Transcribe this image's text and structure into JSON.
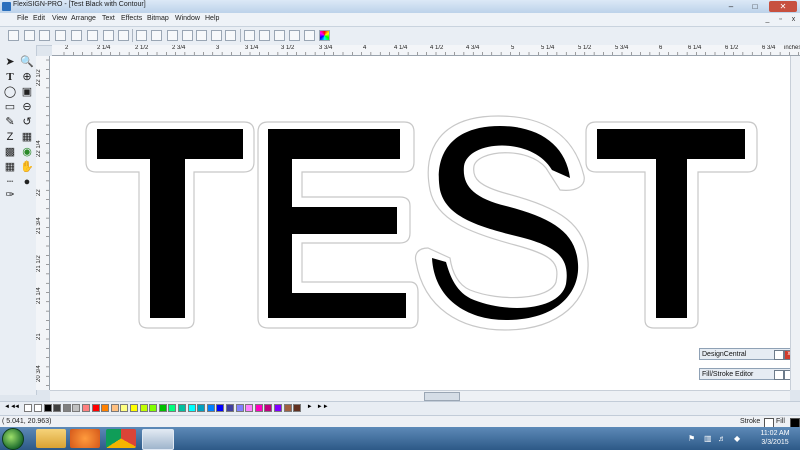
{
  "window": {
    "title": "FlexiSIGN-PRO - [Test Black with Contour]"
  },
  "menu": [
    "File",
    "Edit",
    "View",
    "Arrange",
    "Text",
    "Effects",
    "Bitmap",
    "Window",
    "Help"
  ],
  "ruler": {
    "unit": "inches",
    "h_labels": [
      "2",
      "2 1/4",
      "2 1/2",
      "2 3/4",
      "3",
      "3 1/4",
      "3 1/2",
      "3 3/4",
      "4",
      "4 1/4",
      "4 1/2",
      "4 3/4",
      "5",
      "5 1/4",
      "5 1/2",
      "5 3/4",
      "6",
      "6 1/4",
      "6 1/2",
      "6 3/4"
    ],
    "v_labels": [
      "22 1/2",
      "22 1/4",
      "22",
      "21 3/4",
      "21 1/2",
      "21 1/4",
      "21",
      "20 3/4"
    ]
  },
  "canvas": {
    "text": "TEST"
  },
  "panels": {
    "design_central": "DesignCentral",
    "fill_stroke": "Fill/Stroke Editor"
  },
  "status": {
    "coords": "(      5.041,     20.963)",
    "stroke": "Stroke",
    "fill": "Fill"
  },
  "palette_colors": [
    "#ffffff",
    "#000000",
    "#404040",
    "#808080",
    "#c0c0c0",
    "#ff8080",
    "#ff0000",
    "#ff8000",
    "#ffc080",
    "#ffff80",
    "#ffff00",
    "#c0ff00",
    "#80ff00",
    "#00c000",
    "#00ff80",
    "#00c0a0",
    "#00ffff",
    "#00a0c0",
    "#0080ff",
    "#0000ff",
    "#4040a0",
    "#8080ff",
    "#ff80ff",
    "#ff00c0",
    "#c00080",
    "#8000ff",
    "#a06040",
    "#603020"
  ],
  "taskbar": {
    "time": "11:02 AM",
    "date": "3/3/2015"
  },
  "icons": [
    "app-icon",
    "select-icon",
    "text-icon",
    "zoom-icon",
    "hand-icon",
    "eyedropper-icon",
    "start-orb-icon",
    "folder-icon",
    "media-icon",
    "chrome-icon",
    "flexi-icon"
  ]
}
